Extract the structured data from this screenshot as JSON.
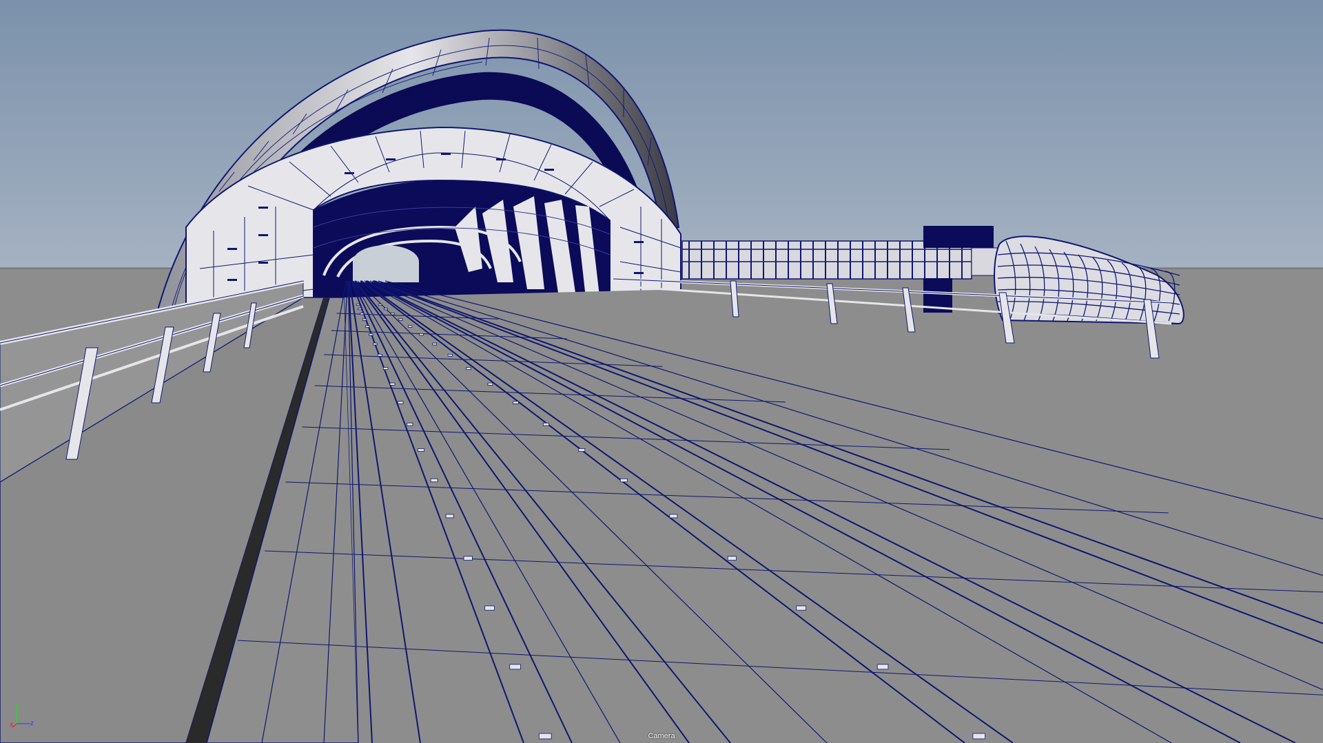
{
  "viewport": {
    "camera_label": "Camera"
  },
  "axis_gizmo": {
    "x_label": "x",
    "y_label": "y",
    "z_label": "z",
    "x_color": "#d23c3c",
    "y_color": "#3cc83c",
    "z_color": "#3c5adc"
  },
  "colors": {
    "sky_top": "#7d93ad",
    "sky_bottom": "#a6b4c4",
    "ground": "#8e8e8e",
    "wire": "#0f1670",
    "shell_white": "#e8e8ec",
    "shell_dark": "#0a0a52"
  }
}
